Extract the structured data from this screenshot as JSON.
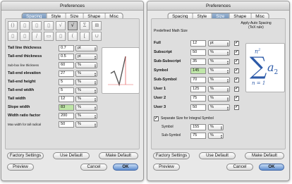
{
  "window1": {
    "title": "Preferences",
    "tabs": [
      "Spacing",
      "Style",
      "Size",
      "Shape",
      "Misc"
    ],
    "active_tab": "Spacing",
    "rows": [
      {
        "label": "Tail line thickness",
        "value": "0.7",
        "unit": "pt"
      },
      {
        "label": "Tail-end thickness",
        "value": "0.5",
        "unit": "pt"
      },
      {
        "label": "Sub-box line thickness",
        "value": "60",
        "unit": "%"
      },
      {
        "label": "Tail-end elevation",
        "value": "27",
        "unit": "%"
      },
      {
        "label": "Tail-end height",
        "value": "5",
        "unit": "%"
      },
      {
        "label": "Tail-end width",
        "value": "5",
        "unit": "%"
      },
      {
        "label": "Tail width",
        "value": "12",
        "unit": "%"
      },
      {
        "label": "Slope width",
        "value": "83",
        "unit": "%"
      },
      {
        "label": "Width ratio factor",
        "value": "200",
        "unit": "%"
      },
      {
        "label": "Max width for tall radical",
        "value": "50",
        "unit": "%"
      }
    ],
    "buttons": {
      "factory": "Factory Settings",
      "use_default": "Use Default",
      "make_default": "Make Default",
      "preview": "Preview",
      "cancel": "Cancel",
      "ok": "OK"
    }
  },
  "window2": {
    "title": "Preferences",
    "tabs": [
      "Spacing",
      "Style",
      "Size",
      "Shape",
      "Misc"
    ],
    "active_tab": "Size",
    "header_left": "Predefined Math Size",
    "header_right": "Apply Auto Spacing",
    "header_right_sub": "(TeX rule)",
    "rows": [
      {
        "label": "Full",
        "value": "12",
        "unit": "pt",
        "checked": true
      },
      {
        "label": "Subscript",
        "value": "50",
        "unit": "%",
        "checked": true
      },
      {
        "label": "Sub-Subscript",
        "value": "35",
        "unit": "%",
        "checked": true
      },
      {
        "label": "Symbol",
        "value": "145",
        "unit": "%",
        "checked": true
      },
      {
        "label": "Sub-Symbol",
        "value": "70",
        "unit": "%",
        "checked": true
      },
      {
        "label": "User 1",
        "value": "125",
        "unit": "%",
        "checked": true
      },
      {
        "label": "User 2",
        "value": "75",
        "unit": "%",
        "checked": true
      },
      {
        "label": "User 3",
        "value": "50",
        "unit": "%",
        "checked": true
      }
    ],
    "separate_label": "Separate Size for Integral Symbol",
    "separate_checked": true,
    "integral_rows": [
      {
        "label": "Symbol",
        "value": "155",
        "unit": "%"
      },
      {
        "label": "Sub-Symbol",
        "value": "75",
        "unit": "%"
      }
    ],
    "preview_formula": {
      "sum_upper": "n",
      "sum_upper_exp": "2",
      "sum_lower": "n = 1",
      "term": "a",
      "term_sub": "2"
    },
    "buttons": {
      "factory": "Factory Settings",
      "use_default": "Use Default",
      "make_default": "Make Default",
      "preview": "Preview",
      "cancel": "Cancel",
      "ok": "OK"
    }
  }
}
